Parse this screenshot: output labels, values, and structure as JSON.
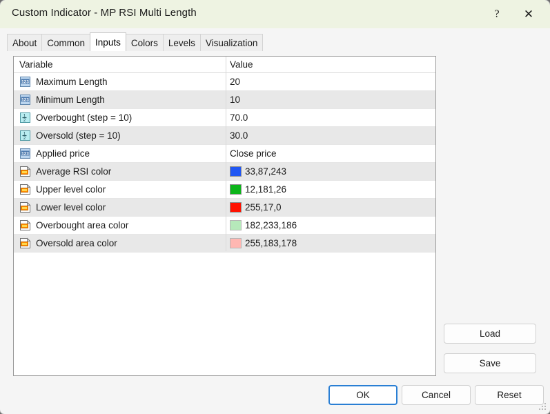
{
  "window": {
    "title": "Custom Indicator - MP RSI Multi Length",
    "help_glyph": "?",
    "close_glyph": "✕"
  },
  "tabs": [
    {
      "label": "About",
      "active": false
    },
    {
      "label": "Common",
      "active": false
    },
    {
      "label": "Inputs",
      "active": true
    },
    {
      "label": "Colors",
      "active": false
    },
    {
      "label": "Levels",
      "active": false
    },
    {
      "label": "Visualization",
      "active": false
    }
  ],
  "table": {
    "headers": {
      "variable": "Variable",
      "value": "Value"
    },
    "rows": [
      {
        "icon": "integer-icon",
        "variable": "Maximum Length",
        "value": "20",
        "swatch": null,
        "shaded": false
      },
      {
        "icon": "integer-icon",
        "variable": "Minimum Length",
        "value": "10",
        "swatch": null,
        "shaded": true
      },
      {
        "icon": "double-icon",
        "variable": "Overbought (step = 10)",
        "value": "70.0",
        "swatch": null,
        "shaded": false
      },
      {
        "icon": "double-icon",
        "variable": "Oversold (step = 10)",
        "value": "30.0",
        "swatch": null,
        "shaded": true
      },
      {
        "icon": "integer-icon",
        "variable": "Applied price",
        "value": "Close price",
        "swatch": null,
        "shaded": false
      },
      {
        "icon": "color-icon",
        "variable": "Average RSI color",
        "value": "33,87,243",
        "swatch": "#2157f3",
        "shaded": true
      },
      {
        "icon": "color-icon",
        "variable": "Upper level color",
        "value": "12,181,26",
        "swatch": "#0cb51a",
        "shaded": false
      },
      {
        "icon": "color-icon",
        "variable": "Lower level color",
        "value": "255,17,0",
        "swatch": "#ff1100",
        "shaded": true
      },
      {
        "icon": "color-icon",
        "variable": "Overbought area color",
        "value": "182,233,186",
        "swatch": "#b6e9ba",
        "shaded": false
      },
      {
        "icon": "color-icon",
        "variable": "Oversold area color",
        "value": "255,183,178",
        "swatch": "#ffb7b2",
        "shaded": true
      }
    ]
  },
  "side_buttons": {
    "load": "Load",
    "save": "Save"
  },
  "bottom_buttons": {
    "ok": "OK",
    "cancel": "Cancel",
    "reset": "Reset"
  }
}
